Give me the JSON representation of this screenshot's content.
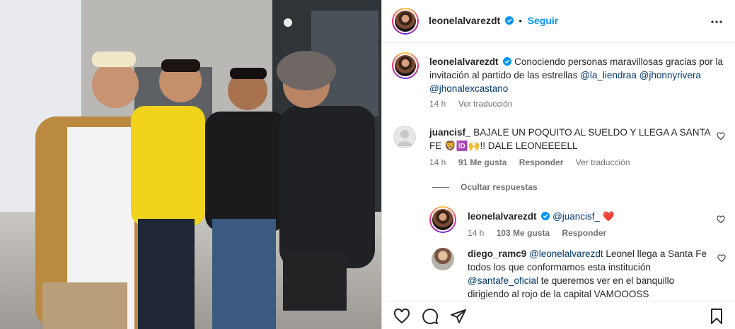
{
  "header": {
    "username": "leonelalvarezdt",
    "separator": "•",
    "follow_label": "Seguir"
  },
  "caption": {
    "username": "leonelalvarezdt",
    "text": "Conociendo personas maravillosas gracias por la invitación al partido de las estrellas",
    "mention1": "@la_liendraa",
    "mention2": "@jhonnyrivera",
    "mention3": "@jhonalexcastano",
    "time": "14 h",
    "translate": "Ver traducción"
  },
  "comments": [
    {
      "username": "juancisf_",
      "text_line1": "BAJALE UN POQUITO AL SUELDO Y LLEGA A SANTA",
      "text_line2_a": "FE",
      "emoji": "🦁🆔🙌",
      "text_line2_b": "!! DALE LEONEEEELL",
      "time": "14 h",
      "likes": "91 Me gusta",
      "reply": "Responder",
      "translate": "Ver traducción",
      "hide_replies": "Ocultar respuestas"
    },
    {
      "username": "leonelalvarezdt",
      "mention": "@juancisf_",
      "emoji": "❤️",
      "time": "14 h",
      "likes": "103 Me gusta",
      "reply": "Responder"
    },
    {
      "username": "diego_ramc9",
      "mention": "@leonelalvarezdt",
      "text_line1": "Leonel llega a Santa",
      "text_line2": "Fe todos los que conformamos esta institución",
      "mention2": "@santafe_oficial",
      "text_line3": "te queremos ver en el banquillo",
      "text_line4": "dirigiendo al rojo de la capital VAMOOOSS"
    }
  ],
  "icons": {
    "more": "more-horizontal-icon",
    "verified": "verified-badge-icon",
    "like": "heart-icon",
    "comment": "comment-icon",
    "share": "share-icon",
    "save": "bookmark-icon"
  },
  "colors": {
    "accent": "#0095f6",
    "verified": "#0095f6",
    "heart_red": "#ed4956",
    "text": "#262626",
    "muted": "#737373"
  }
}
